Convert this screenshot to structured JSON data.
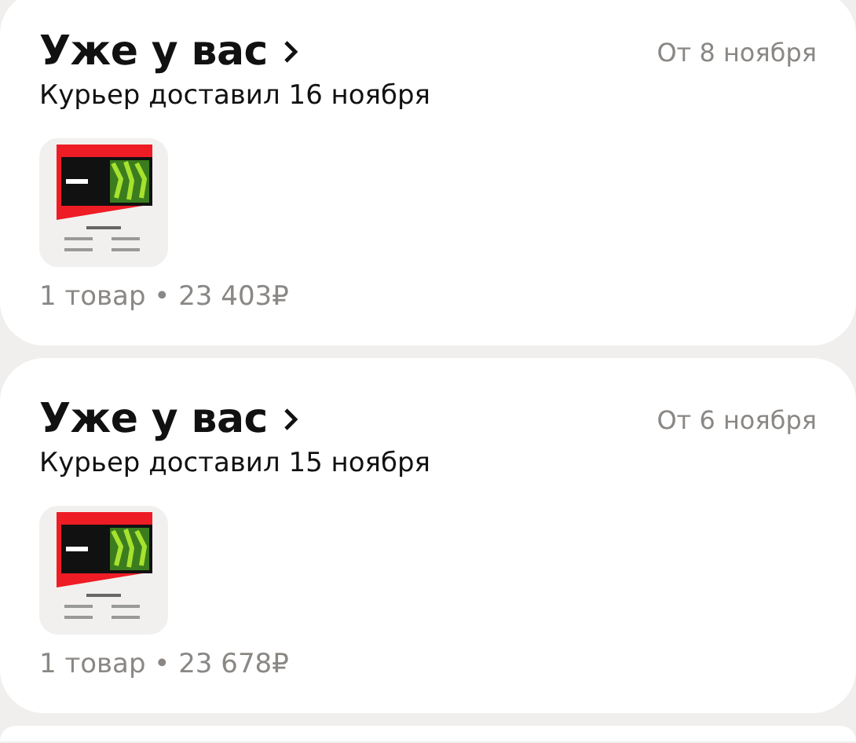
{
  "orders": [
    {
      "title": "Уже у вас",
      "date": "От 8 ноября",
      "status": "Курьер доставил 16 ноября",
      "summary": "1 товар • 23 403₽"
    },
    {
      "title": "Уже у вас",
      "date": "От 6 ноября",
      "status": "Курьер доставил 15 ноября",
      "summary": "1 товар • 23 678₽"
    }
  ]
}
